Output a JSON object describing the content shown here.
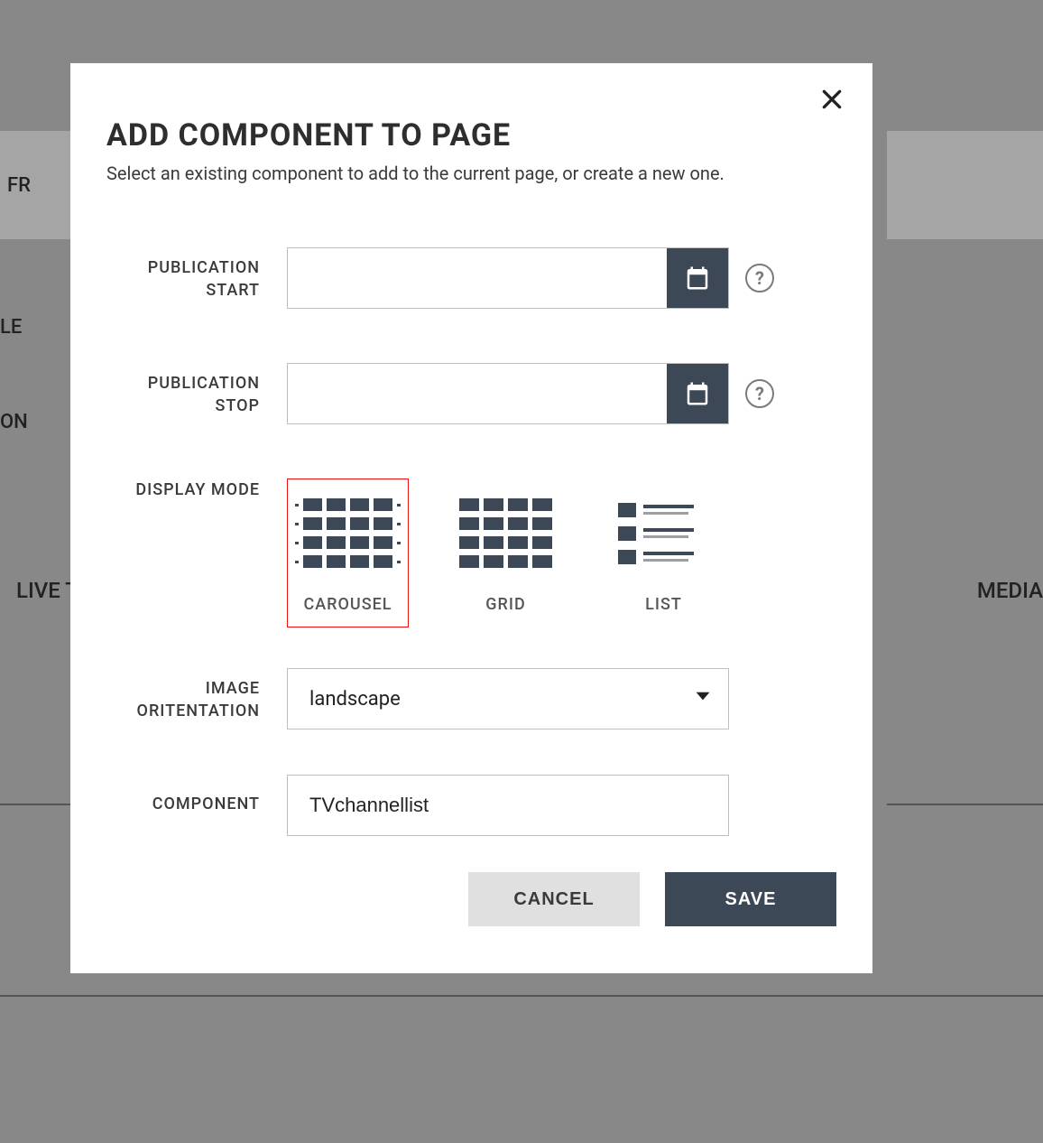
{
  "background": {
    "nav_fr": "FR",
    "row1": "LE",
    "row2": "ON",
    "live_label": "LIVE T",
    "media_label": "MEDIA"
  },
  "modal": {
    "title": "ADD COMPONENT TO PAGE",
    "subtitle": "Select an existing component to add to the current page, or create a new one.",
    "publication_start_label": "PUBLICATION START",
    "publication_start_value": "",
    "publication_stop_label": "PUBLICATION STOP",
    "publication_stop_value": "",
    "display_mode_label": "DISPLAY MODE",
    "display_modes": {
      "carousel": "CAROUSEL",
      "grid": "GRID",
      "list": "LIST"
    },
    "image_orientation_label": "IMAGE ORITENTATION",
    "image_orientation_value": "landscape",
    "component_label": "COMPONENT",
    "component_value": "TVchannellist",
    "cancel_label": "CANCEL",
    "save_label": "SAVE"
  }
}
